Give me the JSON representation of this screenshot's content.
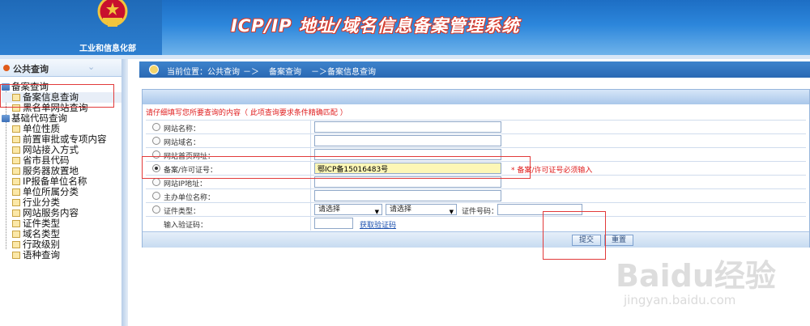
{
  "header": {
    "ministry": "工业和信息化部",
    "system_title": "ICP/IP 地址/域名信息备案管理系统"
  },
  "sidebar": {
    "title": "公共查询",
    "groups": [
      {
        "label": "备案查询",
        "items": [
          "备案信息查询",
          "黑名单网站查询"
        ]
      },
      {
        "label": "基础代码查询",
        "items": [
          "单位性质",
          "前置审批或专项内容",
          "网站接入方式",
          "省市县代码",
          "服务器放置地",
          "IP报备单位名称",
          "单位所属分类",
          "行业分类",
          "网站服务内容",
          "证件类型",
          "域名类型",
          "行政级别",
          "语种查询"
        ]
      }
    ]
  },
  "breadcrumb": {
    "prefix": "当前位置：公共查询",
    "sep1": "－＞",
    "level2": "备案查询",
    "level3": "－＞备案信息查询"
  },
  "form": {
    "notice": "请仔细填写您所要查询的内容（ 此项查询要求条件精确匹配 ）",
    "rows": [
      {
        "label": "网站名称：",
        "value": ""
      },
      {
        "label": "网站域名：",
        "value": ""
      },
      {
        "label": "网站首页网址：",
        "value": ""
      },
      {
        "label": "备案/许可证号：",
        "value": "鄂ICP备15016483号",
        "required_msg": "* 备案/许可证号必须输入"
      },
      {
        "label": "网站IP地址：",
        "value": ""
      },
      {
        "label": "主办单位名称：",
        "value": ""
      }
    ],
    "cert_type_label": "证件类型：",
    "select1": "请选择",
    "select2": "请选择",
    "cert_num_label": "证件号码：",
    "captcha_label": "输入验证码：",
    "captcha_link": "获取验证码",
    "submit": "提交",
    "reset": "重置"
  },
  "watermark": {
    "logo": "Baidu经验",
    "url": "jingyan.baidu.com"
  },
  "colors": {
    "header_blue": "#2c86db",
    "alert_red": "#e02020",
    "highlight_yellow": "#fdf7b6"
  }
}
